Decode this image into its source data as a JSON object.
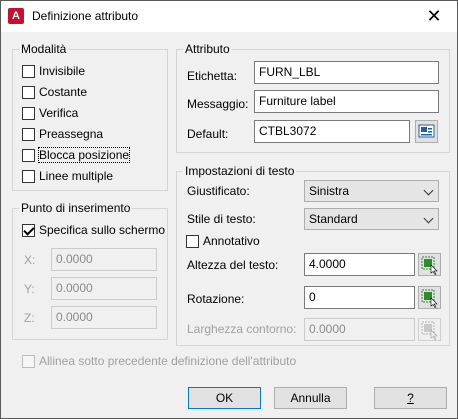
{
  "window": {
    "title": "Definizione attributo",
    "close_glyph": "✕",
    "app_icon": "autocad-icon"
  },
  "mode": {
    "title": "Modalità",
    "items": [
      {
        "label": "Invisibile",
        "checked": false
      },
      {
        "label": "Costante",
        "checked": false
      },
      {
        "label": "Verifica",
        "checked": false
      },
      {
        "label": "Preassegna",
        "checked": false
      },
      {
        "label": "Blocca posizione",
        "checked": false
      },
      {
        "label": "Linee multiple",
        "checked": false
      }
    ]
  },
  "insertion": {
    "title": "Punto di inserimento",
    "specify_label": "Specifica sullo schermo",
    "specify_checked": true,
    "x_label": "X:",
    "x_value": "0.0000",
    "y_label": "Y:",
    "y_value": "0.0000",
    "z_label": "Z:",
    "z_value": "0.0000"
  },
  "attribute": {
    "title": "Attributo",
    "tag_label": "Etichetta:",
    "tag_value": "FURN_LBL",
    "prompt_label": "Messaggio:",
    "prompt_value": "Furniture label",
    "default_label": "Default:",
    "default_value": "CTBL3072"
  },
  "text_settings": {
    "title": "Impostazioni di testo",
    "justify_label": "Giustificato:",
    "justify_value": "Sinistra",
    "style_label": "Stile di testo:",
    "style_value": "Standard",
    "annotative_label": "Annotativo",
    "annotative_checked": false,
    "height_label": "Altezza del testo:",
    "height_value": "4.0000",
    "rotation_label": "Rotazione:",
    "rotation_value": "0",
    "width_label": "Larghezza contorno:",
    "width_value": "0.0000"
  },
  "align_below": {
    "label": "Allinea sotto precedente definizione dell'attributo",
    "checked": false
  },
  "buttons": {
    "ok": "OK",
    "cancel": "Annulla",
    "help": "?"
  },
  "colors": {
    "accent": "#0078d7",
    "app_icon": "#c8102e",
    "pick_green": "#2e8b2e"
  }
}
